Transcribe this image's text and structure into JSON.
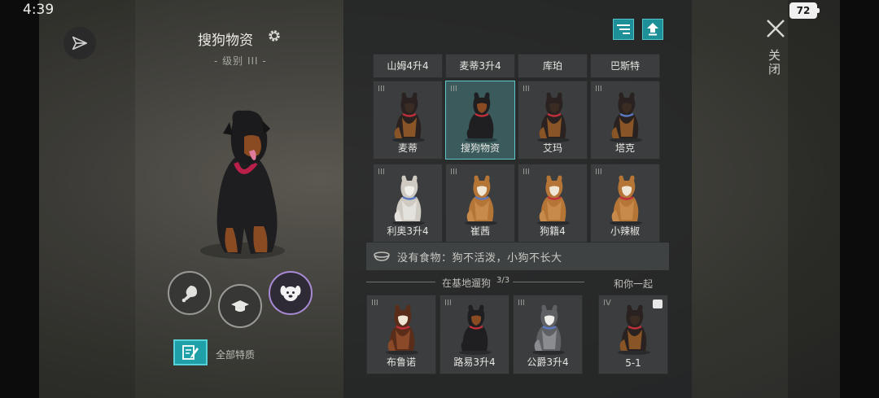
{
  "status": {
    "time": "4:39",
    "battery": "72"
  },
  "header": {
    "close_label": "关闭"
  },
  "dog": {
    "name": "搜狗物资",
    "level": "- 级别 III -"
  },
  "actions": [
    {
      "icon": "meat-icon"
    },
    {
      "icon": "graduation-cap-icon"
    },
    {
      "icon": "dog-face-icon"
    }
  ],
  "traits": {
    "label": "全部特质"
  },
  "grid_top_row": [
    {
      "name": "山姆4升4"
    },
    {
      "name": "麦蒂3升4"
    },
    {
      "name": "库珀"
    },
    {
      "name": "巴斯特"
    }
  ],
  "grid": [
    {
      "level": "III",
      "name": "麦蒂",
      "breed": "shepherd",
      "collar": "#c0303a"
    },
    {
      "level": "III",
      "name": "搜狗物资",
      "breed": "rottweiler",
      "collar": "#c0303a"
    },
    {
      "level": "III",
      "name": "艾玛",
      "breed": "shepherd",
      "collar": "#c0303a"
    },
    {
      "level": "III",
      "name": "塔克",
      "breed": "shepherd",
      "collar": "#5a78c0"
    },
    {
      "level": "III",
      "name": "利奥3升4",
      "breed": "white",
      "collar": "#5a78c0"
    },
    {
      "level": "III",
      "name": "崔茜",
      "breed": "shiba",
      "collar": "#5a78c0"
    },
    {
      "level": "III",
      "name": "狗籍4",
      "breed": "shiba",
      "collar": "#c0303a"
    },
    {
      "level": "III",
      "name": "小辣椒",
      "breed": "shiba",
      "collar": "#c0303a"
    }
  ],
  "food_notice": "没有食物：狗不活泼，小狗不长大",
  "walking": {
    "title": "在基地遛狗",
    "count": "3/3",
    "with_you_label": "和你一起",
    "dogs": [
      {
        "level": "III",
        "name": "布鲁诺",
        "breed": "husky-red",
        "collar": "#c0303a"
      },
      {
        "level": "III",
        "name": "路易3升4",
        "breed": "rottweiler",
        "collar": "#c0303a"
      },
      {
        "level": "III",
        "name": "公爵3升4",
        "breed": "husky-grey",
        "collar": "#5a78c0"
      }
    ],
    "companion": {
      "level": "IV",
      "name": "5-1",
      "breed": "shepherd",
      "collar": "#c0303a"
    }
  },
  "colors": {
    "accent_teal": "#1fa0a8",
    "selected_border": "#5fc7c9",
    "active_purple": "#a98ad4"
  }
}
